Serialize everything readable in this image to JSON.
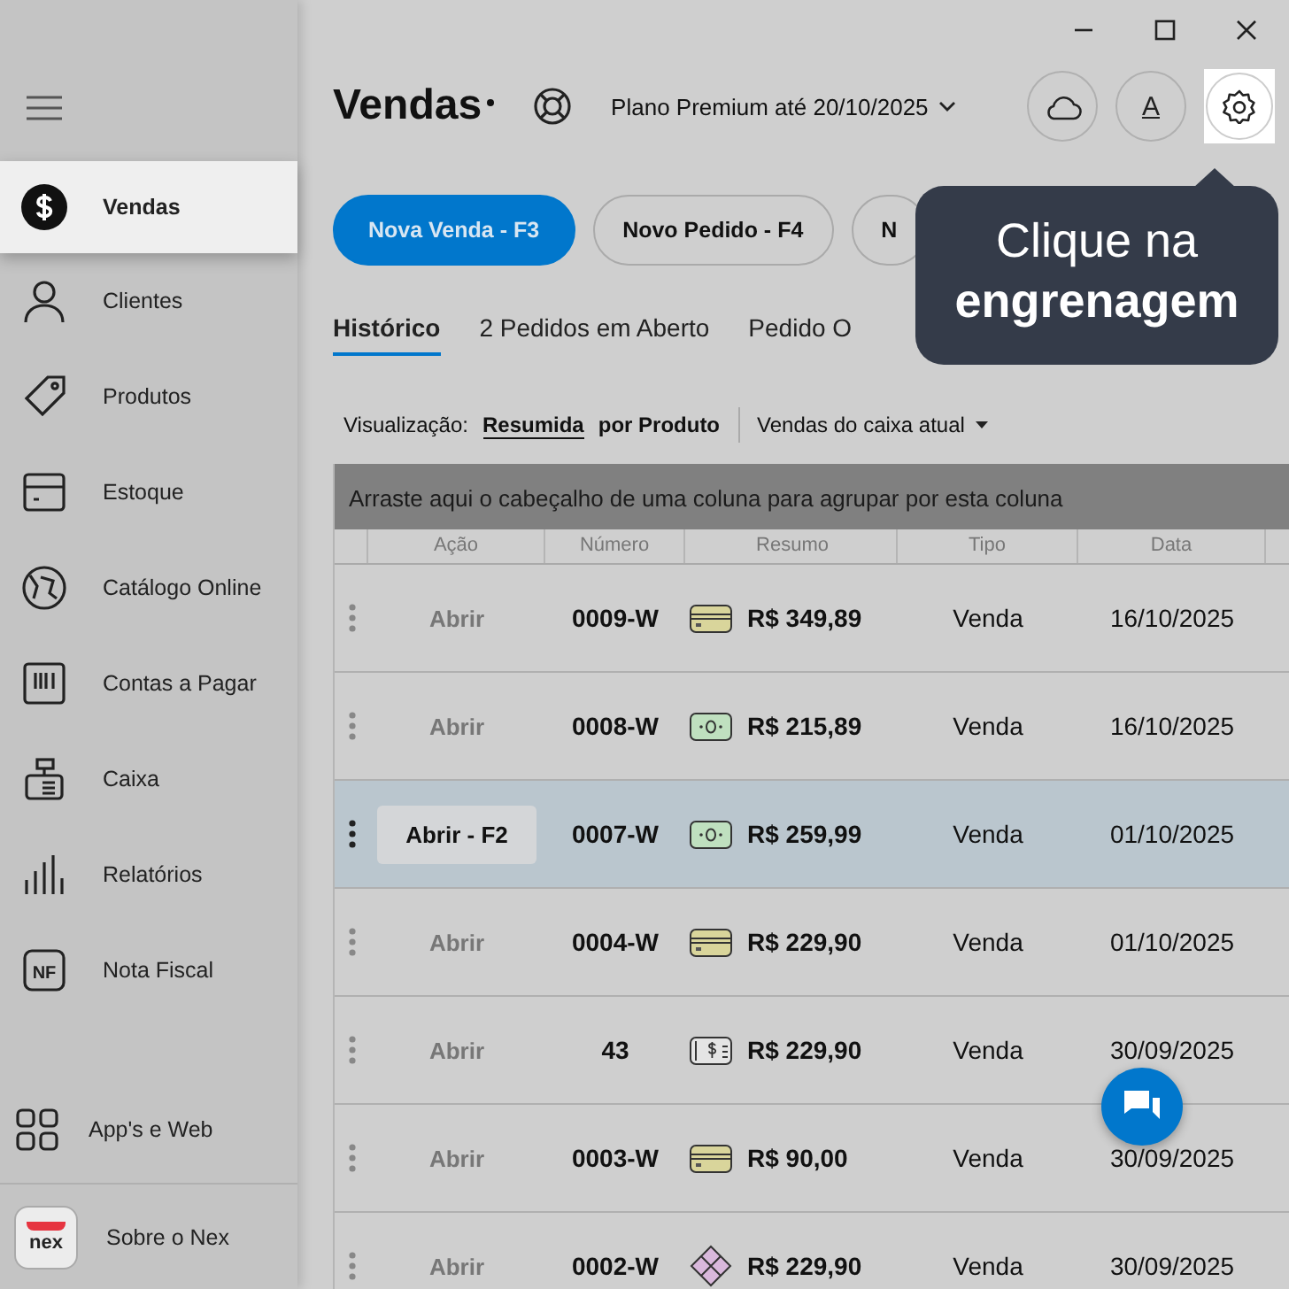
{
  "sidebar": {
    "items": [
      {
        "label": "Vendas",
        "kind": "dollar",
        "selected": true
      },
      {
        "label": "Clientes",
        "kind": "person",
        "selected": false
      },
      {
        "label": "Produtos",
        "kind": "tag",
        "selected": false
      },
      {
        "label": "Estoque",
        "kind": "box",
        "selected": false
      },
      {
        "label": "Catálogo Online",
        "kind": "globe",
        "selected": false
      },
      {
        "label": "Contas a Pagar",
        "kind": "barcode",
        "selected": false
      },
      {
        "label": "Caixa",
        "kind": "register",
        "selected": false
      },
      {
        "label": "Relatórios",
        "kind": "bars",
        "selected": false
      },
      {
        "label": "Nota Fiscal",
        "kind": "invoice",
        "badge": "NF",
        "selected": false
      }
    ],
    "bottom_items": [
      {
        "label": "App's e Web",
        "kind": "grid"
      },
      {
        "label": "Sobre o Nex",
        "kind": "logo",
        "logo_text": "nex"
      }
    ]
  },
  "header": {
    "title": "Vendas",
    "plan": "Plano Premium até 20/10/2025",
    "font_button": "A"
  },
  "actions": [
    {
      "label": "Nova Venda - F3",
      "primary": true
    },
    {
      "label": "Novo Pedido - F4",
      "primary": false
    },
    {
      "label": "N",
      "primary": false
    }
  ],
  "tabs": [
    {
      "label": "Histórico",
      "selected": true
    },
    {
      "label": "2 Pedidos em Aberto",
      "selected": false
    },
    {
      "label": "Pedido O",
      "selected": false
    }
  ],
  "view": {
    "label": "Visualização:",
    "options": [
      {
        "label": "Resumida",
        "selected": true
      },
      {
        "label": "por Produto",
        "selected": false
      }
    ],
    "filter": "Vendas do caixa atual"
  },
  "group_hint": "Arraste aqui o cabeçalho de uma coluna para agrupar por esta coluna",
  "table": {
    "columns": [
      "Ação",
      "Número",
      "Resumo",
      "Tipo",
      "Data"
    ],
    "rows": [
      {
        "action": "Abrir",
        "number": "0009-W",
        "kind": "card",
        "total": "R$ 349,89",
        "type": "Venda",
        "date": "16/10/2025",
        "selected": false
      },
      {
        "action": "Abrir",
        "number": "0008-W",
        "kind": "cash",
        "total": "R$ 215,89",
        "type": "Venda",
        "date": "16/10/2025",
        "selected": false
      },
      {
        "action": "Abrir - F2",
        "number": "0007-W",
        "kind": "cash",
        "total": "R$ 259,99",
        "type": "Venda",
        "date": "01/10/2025",
        "selected": true
      },
      {
        "action": "Abrir",
        "number": "0004-W",
        "kind": "card",
        "total": "R$ 229,90",
        "type": "Venda",
        "date": "01/10/2025",
        "selected": false
      },
      {
        "action": "Abrir",
        "number": "43",
        "kind": "boleto",
        "total": "R$ 229,90",
        "type": "Venda",
        "date": "30/09/2025",
        "selected": false
      },
      {
        "action": "Abrir",
        "number": "0003-W",
        "kind": "card",
        "total": "R$ 90,00",
        "type": "Venda",
        "date": "30/09/2025",
        "selected": false
      },
      {
        "action": "Abrir",
        "number": "0002-W",
        "kind": "pix",
        "total": "R$ 229,90",
        "type": "Venda",
        "date": "30/09/2025",
        "selected": false
      }
    ]
  },
  "tooltip": {
    "line1": "Clique na",
    "line2": "engrenagem"
  }
}
